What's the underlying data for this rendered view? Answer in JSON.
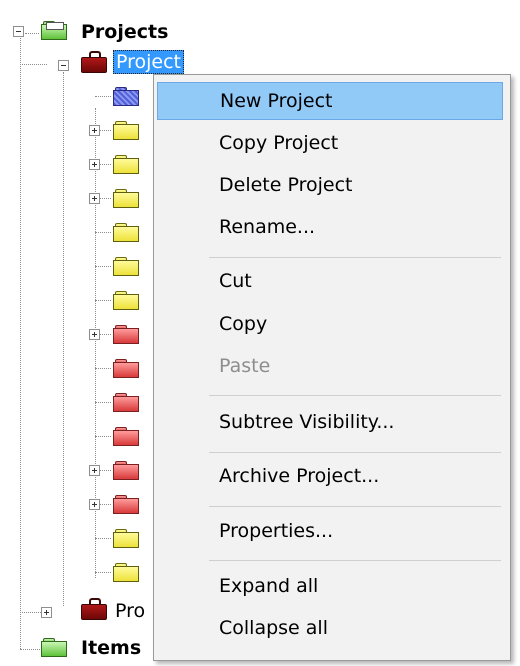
{
  "tree": {
    "root_label": "Projects",
    "selected_label": "Project",
    "sibling_label_partial": "Pro",
    "items_label": "Items",
    "icons": {
      "root": "green-folder-icon",
      "project": "briefcase-icon",
      "children": [
        "blue",
        "yellow",
        "yellow",
        "yellow",
        "yellow",
        "yellow",
        "yellow",
        "red",
        "red",
        "red",
        "red",
        "red",
        "red",
        "yellow",
        "yellow"
      ]
    }
  },
  "context_menu": {
    "items": [
      {
        "label": "New Project",
        "state": "hover"
      },
      {
        "label": "Copy Project",
        "state": "normal"
      },
      {
        "label": "Delete Project",
        "state": "normal"
      },
      {
        "label": "Rename...",
        "state": "normal"
      },
      {
        "label": "Cut",
        "state": "normal"
      },
      {
        "label": "Copy",
        "state": "normal"
      },
      {
        "label": "Paste",
        "state": "disabled"
      },
      {
        "label": "Subtree Visibility...",
        "state": "normal"
      },
      {
        "label": "Archive Project...",
        "state": "normal"
      },
      {
        "label": "Properties...",
        "state": "normal"
      },
      {
        "label": "Expand all",
        "state": "normal"
      },
      {
        "label": "Collapse all",
        "state": "normal"
      }
    ]
  },
  "colors": {
    "selection": "#3399ff",
    "menu_hover": "#91c9f7",
    "menu_background": "#f2f2f2",
    "disabled_text": "#8d8d8d"
  }
}
